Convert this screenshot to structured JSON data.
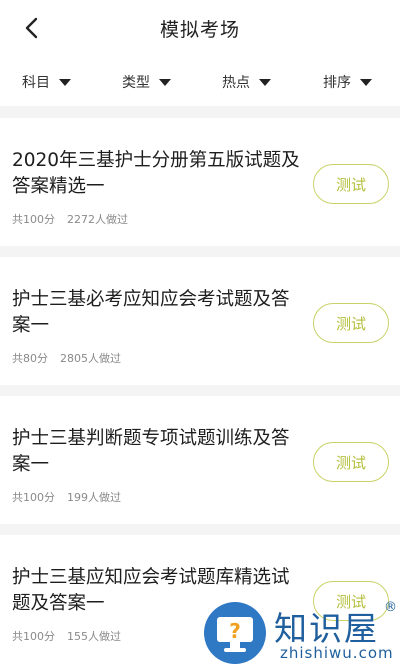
{
  "header": {
    "title": "模拟考场",
    "back_icon": "chevron-left-icon"
  },
  "filters": [
    {
      "label": "科目",
      "icon": "triangle-down-icon"
    },
    {
      "label": "类型",
      "icon": "triangle-down-icon"
    },
    {
      "label": "热点",
      "icon": "triangle-down-icon"
    },
    {
      "label": "排序",
      "icon": "triangle-down-icon"
    }
  ],
  "cards": [
    {
      "title": "2020年三基护士分册第五版试题及答案精选一",
      "score": "共100分",
      "takers": "2272人做过",
      "button": "测试"
    },
    {
      "title": "护士三基必考应知应会考试题及答案一",
      "score": "共80分",
      "takers": "2805人做过",
      "button": "测试"
    },
    {
      "title": "护士三基判断题专项试题训练及答案一",
      "score": "共100分",
      "takers": "199人做过",
      "button": "测试"
    },
    {
      "title": "护士三基应知应会考试题库精选试题及答案一",
      "score": "共100分",
      "takers": "155人做过",
      "button": "测试"
    }
  ],
  "watermark": {
    "title": "知识屋",
    "registered": "®",
    "url": "zhishiwu.com",
    "icon": "question-mark-screen-icon"
  },
  "colors": {
    "accent": "#b4bf3c",
    "accent_border": "#c9d267",
    "watermark": "#1f5f9d",
    "background": "#f4f4f4"
  }
}
